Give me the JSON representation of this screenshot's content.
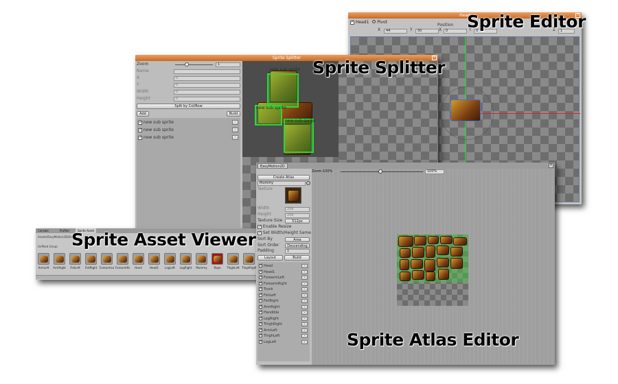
{
  "sprite_editor": {
    "window_title": "Head",
    "caption": "Sprite Editor",
    "sprite_name": "Head1",
    "pivot_label": "Pivot",
    "position_label": "Position",
    "pivot_x_label": "X",
    "pivot_x": "44",
    "pivot_y_label": "Y",
    "pivot_y": "50",
    "pos_x_label": "X",
    "pos_x": "0",
    "pos_y_label": "Y",
    "pos_y": "0",
    "pos_z_label": "Z",
    "pos_z": "1"
  },
  "sprite_splitter": {
    "window_title": "Sprite Splitter",
    "caption": "Sprite Splitter",
    "zoom_label": "Zoom",
    "zoom_value": "1",
    "name_label": "Name",
    "x_label": "X",
    "x_value": "0",
    "y_label": "Y",
    "y_value": "0",
    "width_label": "Width",
    "width_value": "0",
    "height_label": "Height",
    "height_value": "0",
    "split_button": "Split by Col/Row",
    "add_button": "Add",
    "build_button": "Build",
    "sub_sprites": [
      "new sub sprite",
      "new sub sprite",
      "new sub sprite"
    ],
    "canvas_labels": [
      "new sub sprite",
      "new sub sprite",
      "new sub sprite"
    ]
  },
  "asset_viewer": {
    "caption": "Sprite Asset Viewer",
    "tabs": [
      "Console",
      "Profiler",
      "Sprite Asset"
    ],
    "path": "Assets/EasyMotion2D/Demo",
    "section": "Unfilled Group",
    "thumbnails": [
      "ArmLeft",
      "ArmRight",
      "FistLeft",
      "FistRight",
      "ForearmLeft",
      "ForearmRight",
      "Hand",
      "Head1",
      "LegLeft",
      "LegRight",
      "Mummy",
      "Rope",
      "ThighLeft",
      "ThighRight"
    ]
  },
  "atlas_editor": {
    "tab": "EasyMotion2D",
    "caption": "Sprite Atlas Editor",
    "zoom_label": "Zoom:100%",
    "zoom_value": "100%",
    "create_button": "Create Atlas",
    "atlas_name": "Mummy",
    "texture_label": "Texture",
    "width_label": "Width",
    "width_value": "256",
    "height_label": "Height",
    "height_value": "256",
    "texture_size_label": "Texture Size",
    "texture_size_value": "512px",
    "enable_resize": "Enable Resize",
    "set_wh_same": "Set Width/Height Same",
    "sort_by_label": "Sort By",
    "sort_by_value": "Area",
    "sort_order_label": "Sort Order",
    "sort_order_value": "Descending",
    "padding_label": "Padding",
    "padding_value": "1",
    "layout_button": "Layout",
    "build_button": "Build",
    "sprites": [
      "Head",
      "Head1",
      "ForearmLeft",
      "ForearmRight",
      "Trunk",
      "FistLeft",
      "FistRight",
      "ArmRight",
      "Handible",
      "LegRight",
      "ThighRight",
      "ArmLeft",
      "ThighLeft",
      "LegLeft"
    ]
  }
}
